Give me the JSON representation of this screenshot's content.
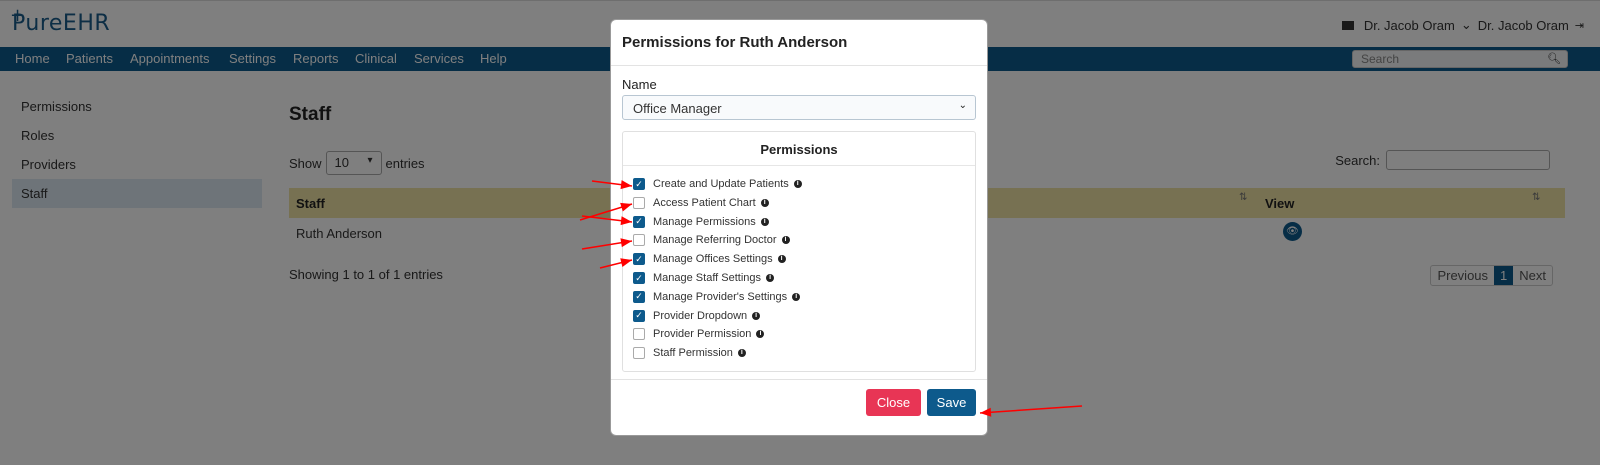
{
  "header": {
    "logo": "PureEHR",
    "user_name": "Dr. Jacob Oram",
    "user_menu": "Dr. Jacob Oram"
  },
  "nav": {
    "items": [
      "Home",
      "Patients",
      "Appointments",
      "Settings",
      "Reports",
      "Clinical",
      "Services",
      "Help"
    ],
    "search_placeholder": "Search"
  },
  "sidebar": {
    "items": [
      {
        "label": "Permissions",
        "active": false
      },
      {
        "label": "Roles",
        "active": false
      },
      {
        "label": "Providers",
        "active": false
      },
      {
        "label": "Staff",
        "active": true
      }
    ]
  },
  "main": {
    "title": "Staff",
    "show_label": "Show",
    "entries_value": "10",
    "entries_label": "entries",
    "search_label": "Search:",
    "columns": [
      "Staff",
      "View"
    ],
    "rows": [
      {
        "staff": "Ruth Anderson"
      }
    ],
    "showing": "Showing 1 to 1 of 1 entries",
    "pager": {
      "prev": "Previous",
      "current": "1",
      "next": "Next"
    }
  },
  "modal": {
    "title": "Permissions for Ruth Anderson",
    "name_label": "Name",
    "name_value": "Office Manager",
    "permissions_title": "Permissions",
    "permissions": [
      {
        "label": "Create and Update Patients",
        "checked": true
      },
      {
        "label": "Access Patient Chart",
        "checked": false
      },
      {
        "label": "Manage Permissions",
        "checked": true
      },
      {
        "label": "Manage Referring Doctor",
        "checked": false
      },
      {
        "label": "Manage Offices Settings",
        "checked": true
      },
      {
        "label": "Manage Staff Settings",
        "checked": true
      },
      {
        "label": "Manage Provider's Settings",
        "checked": true
      },
      {
        "label": "Provider Dropdown",
        "checked": true
      },
      {
        "label": "Provider Permission",
        "checked": false
      },
      {
        "label": "Staff Permission",
        "checked": false
      }
    ],
    "close_label": "Close",
    "save_label": "Save"
  },
  "colors": {
    "primary": "#0d5a8c",
    "danger": "#e83555",
    "table_header": "#efe2a4",
    "annotation_arrow": "#ff0000"
  }
}
